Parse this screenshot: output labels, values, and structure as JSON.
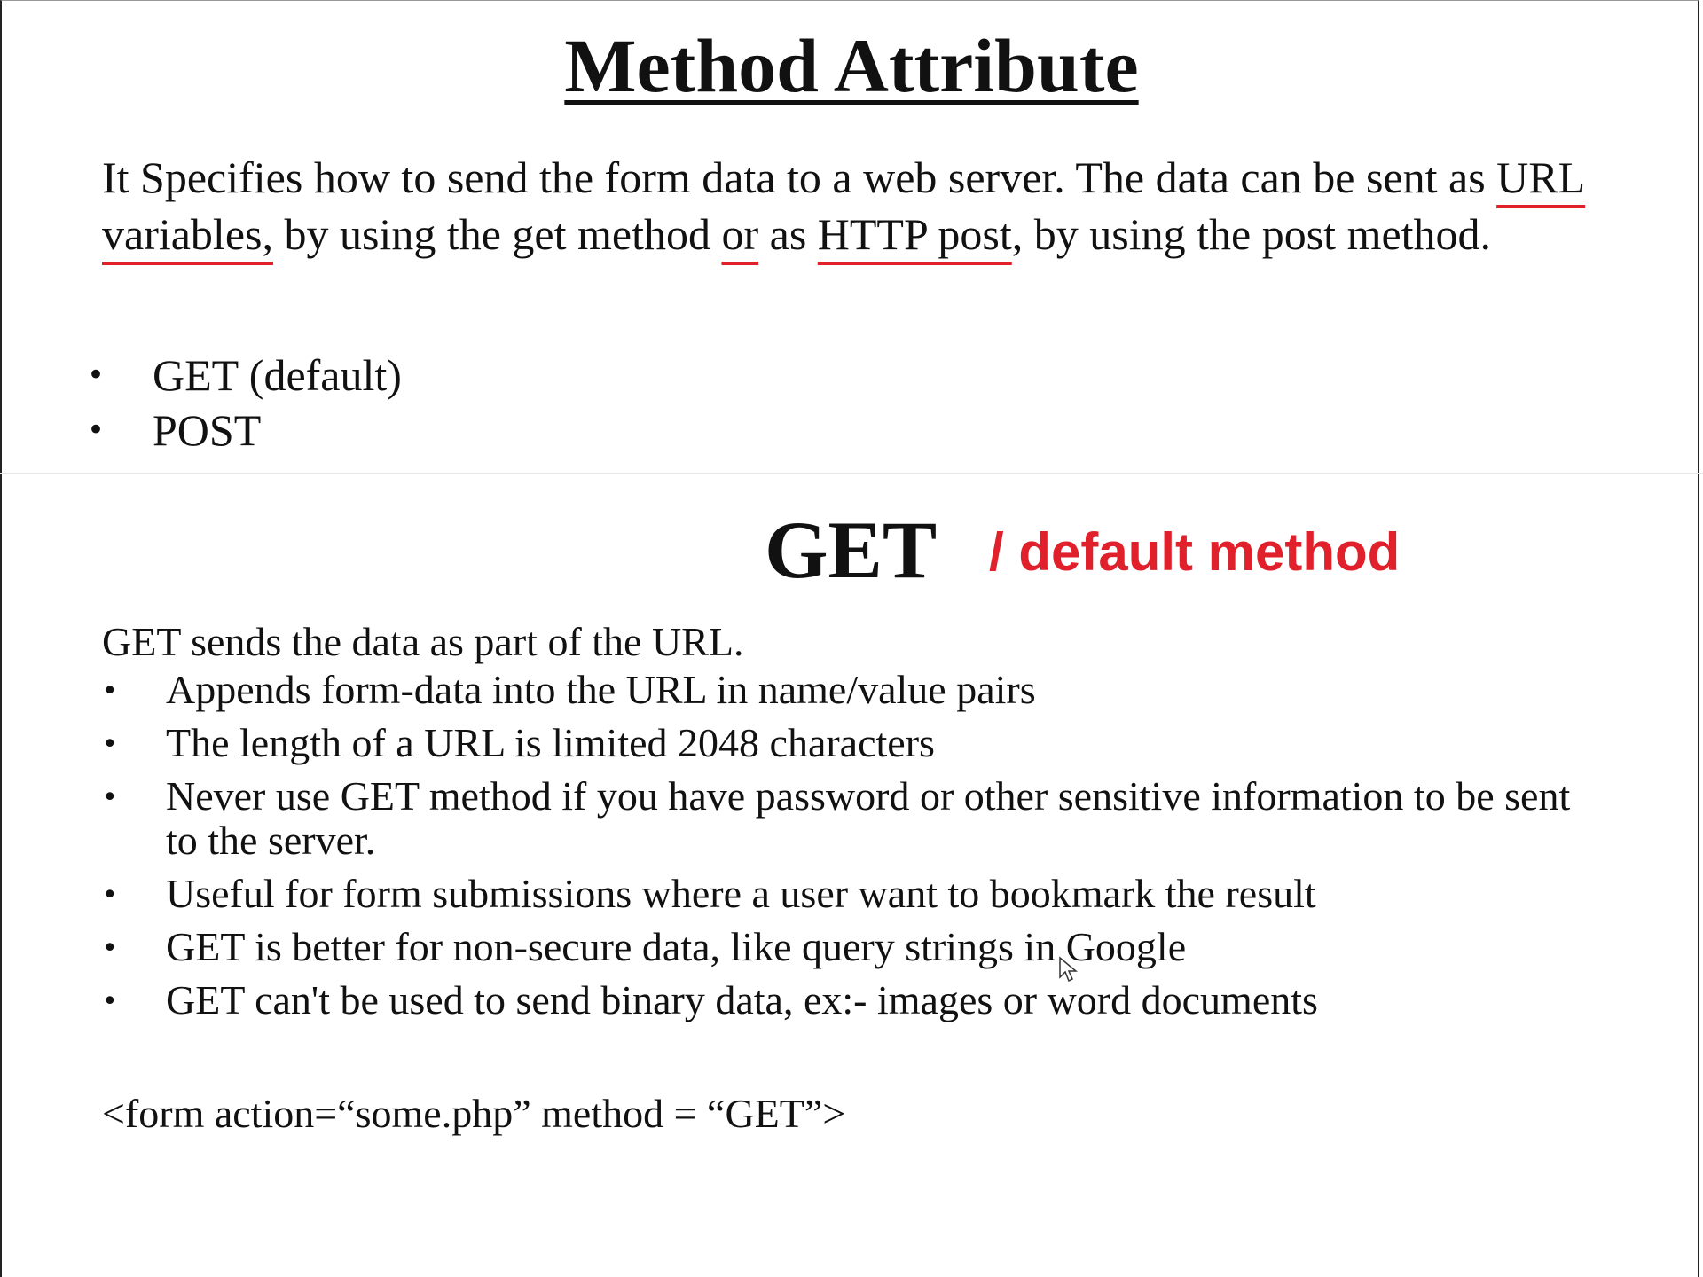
{
  "slide1": {
    "title": "Method Attribute",
    "intro": {
      "part1": "It Specifies how to send the form data to a web server. The data can be sent as ",
      "hl1": "URL variables,",
      "part2": " by using the get method ",
      "hl2": "or",
      "part3": " as ",
      "hl3": "HTTP post",
      "part4": ", by using the post method."
    },
    "methods": [
      "GET (default)",
      "POST"
    ],
    "bullet": "•"
  },
  "slide2": {
    "title": "GET",
    "note": "/ default method",
    "lead": "GET sends the data as part of the URL.",
    "points": [
      "Appends form-data into the URL in name/value pairs",
      "The length of a URL is limited 2048 characters",
      "Never use GET method if you have password or other sensitive information to be sent to the server.",
      "Useful for form submissions where a user want to bookmark the result",
      "GET is better for non-secure data, like query strings in Google",
      "GET can't be used to send binary data, ex:-  images or word documents"
    ],
    "code": "<form action=“some.php” method = “GET”>"
  },
  "colors": {
    "annotation": "#e0202a",
    "text": "#111111"
  },
  "icons": {
    "cursor": "mouse-pointer-icon"
  }
}
